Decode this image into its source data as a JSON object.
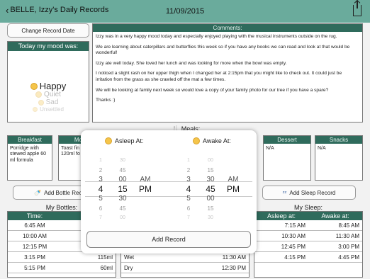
{
  "topbar": {
    "back_label": "BELLE, Izzy's Daily Records",
    "date": "11/09/2015"
  },
  "change_date_label": "Change Record Date",
  "mood": {
    "header": "Today my mood was:",
    "options": [
      "Happy",
      "Quiet",
      "Sad",
      "Unsettled"
    ]
  },
  "comments": {
    "header": "Comments:",
    "paragraphs": [
      "Izzy was in a very happy mood today and especially enjoyed playing with the musical instruments outside on the rug.",
      "We are learning about caterpillars and butterflies this week so if you have any books we can read and look at that would be wonderful!",
      "Izzy ate well today. She loved her lunch and was looking for more when the bowl was empty.",
      "I noticed a slight rash on her upper thigh when I changed her at 2:15pm that you might like to check out. It could just be irritation from the grass as she crawled off the mat a few times.",
      "We will be looking at family next week so would love a copy of your family photo for our tree if you have a spare?",
      "Thanks :)"
    ]
  },
  "meals": {
    "title": "Meals:",
    "boxes": [
      {
        "header": "Breakfast",
        "body": "Porridge with stewed apple 60 ml formula"
      },
      {
        "header": "Morn",
        "body": "Toast fin plain 120ml fo"
      },
      {
        "header": "Dessert",
        "body": "N/A"
      },
      {
        "header": "Snacks",
        "body": "N/A"
      }
    ]
  },
  "buttons": {
    "add_bottle": "Add Bottle Reco",
    "add_sleep": "Add Sleep Record"
  },
  "bottles": {
    "title": "My Bottles:",
    "col_time": "Time:",
    "rows": [
      {
        "time": "6:45 AM",
        "amount": ""
      },
      {
        "time": "10:00 AM",
        "amount": ""
      },
      {
        "time": "12:15 PM",
        "amount": ""
      },
      {
        "time": "3:15 PM",
        "amount": "115ml"
      },
      {
        "time": "5:15 PM",
        "amount": "60ml"
      }
    ]
  },
  "nappies": {
    "rows": [
      {
        "type": "Wet",
        "time": "11:30 AM"
      },
      {
        "type": "Dry",
        "time": "12:30 PM"
      }
    ]
  },
  "sleep": {
    "title": "My Sleep:",
    "col_asleep": "Asleep at:",
    "col_awake": "Awake at:",
    "rows": [
      {
        "asleep": "7:15 AM",
        "awake": "8:45 AM"
      },
      {
        "asleep": "10:30 AM",
        "awake": "11:30 AM"
      },
      {
        "asleep": "12:45 PM",
        "awake": "3:00 PM"
      },
      {
        "asleep": "4:15 PM",
        "awake": "4:45 PM"
      }
    ]
  },
  "picker": {
    "asleep_label": "Asleep At:",
    "awake_label": "Awake At:",
    "asleep_hours": [
      "1",
      "2",
      "3",
      "4",
      "5",
      "6",
      "7"
    ],
    "asleep_minutes": [
      "30",
      "45",
      "00",
      "15",
      "30",
      "45",
      "00"
    ],
    "asleep_ampm": [
      "AM",
      "PM"
    ],
    "awake_hours": [
      "1",
      "2",
      "3",
      "4",
      "5",
      "6",
      "7"
    ],
    "awake_minutes": [
      "00",
      "15",
      "30",
      "45",
      "00",
      "15",
      "30"
    ],
    "awake_ampm": [
      "AM",
      "PM"
    ],
    "add_record": "Add Record"
  }
}
